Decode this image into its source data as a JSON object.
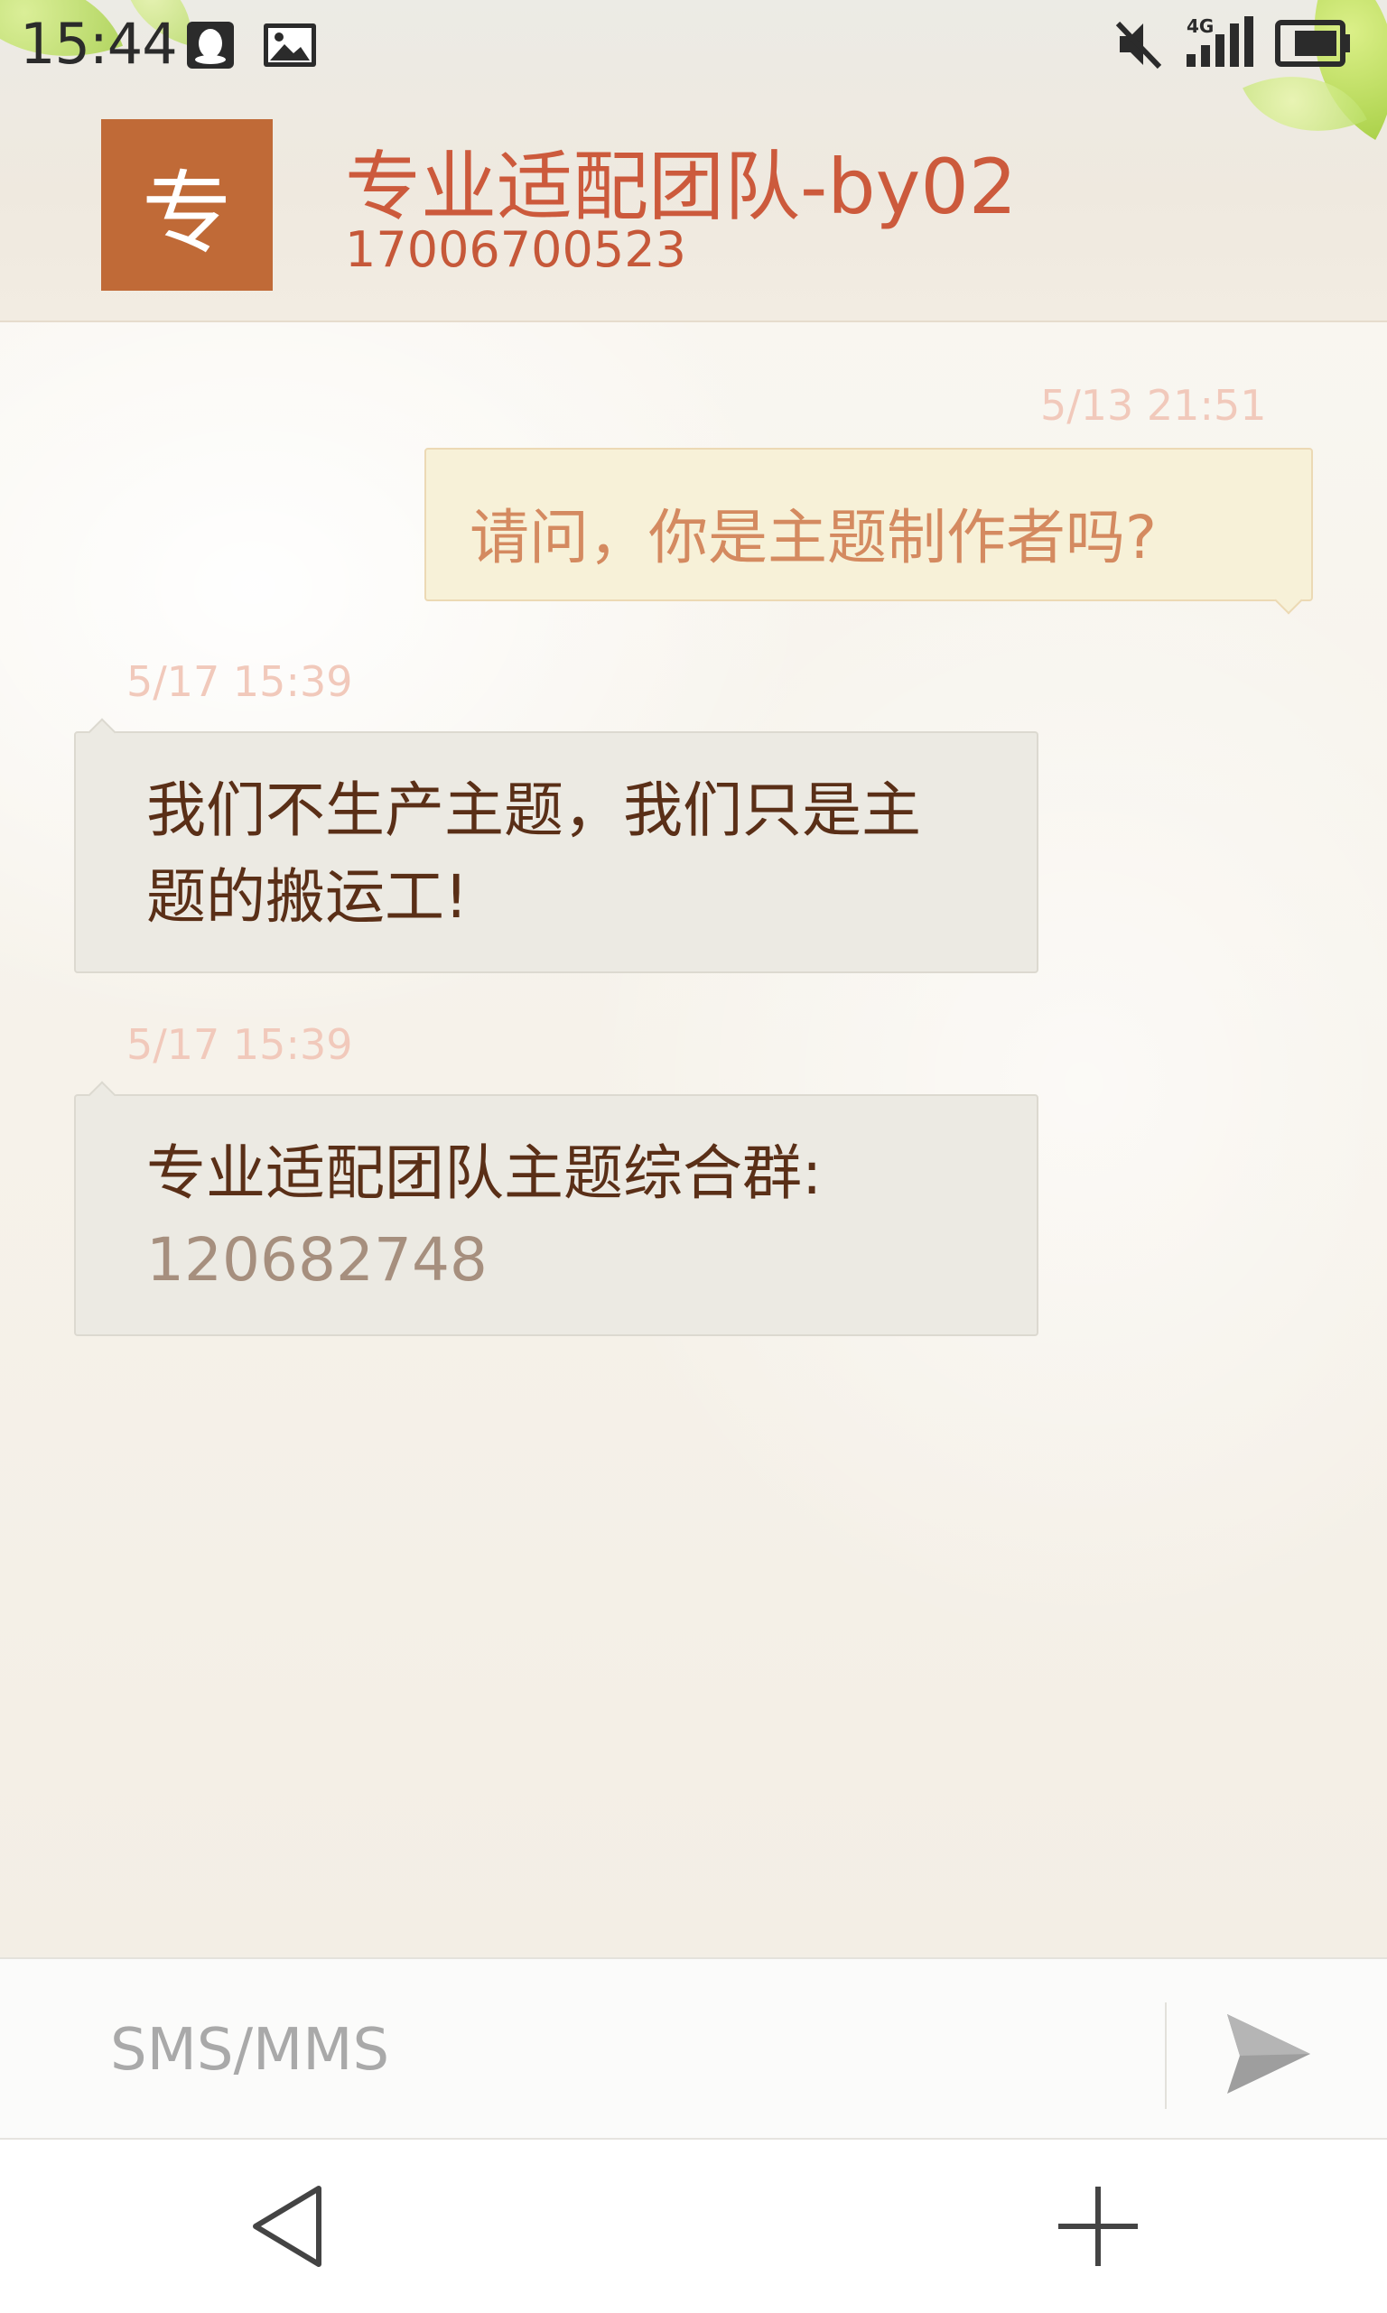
{
  "status_bar": {
    "time": "15:44",
    "left_icons": [
      "qq-icon",
      "image-icon"
    ],
    "right_icons": [
      "mute-icon",
      "signal-4g-icon",
      "battery-icon"
    ],
    "network": "4G"
  },
  "header": {
    "avatar_letter": "专",
    "avatar_color": "#c06a37",
    "contact_name": "专业适配团队-by02",
    "contact_number": "17006700523"
  },
  "messages": [
    {
      "direction": "outgoing",
      "timestamp": "5/13 21:51",
      "text": "请问，你是主题制作者吗?"
    },
    {
      "direction": "incoming",
      "timestamp": "5/17 15:39",
      "line1": "我们不生产主题，我们只是主",
      "line2": "题的搬运工!"
    },
    {
      "direction": "incoming",
      "timestamp": "5/17 15:39",
      "text": "专业适配团队主题综合群:",
      "group_number": "120682748"
    }
  ],
  "composer": {
    "placeholder": "SMS/MMS",
    "send_icon": "send-icon"
  },
  "navbar": {
    "back_icon": "back-triangle-icon",
    "add_icon": "plus-icon"
  },
  "colors": {
    "accent": "#cc5a3c",
    "outgoing_bubble": "#f7f1d8",
    "incoming_bubble": "#eceae3"
  }
}
